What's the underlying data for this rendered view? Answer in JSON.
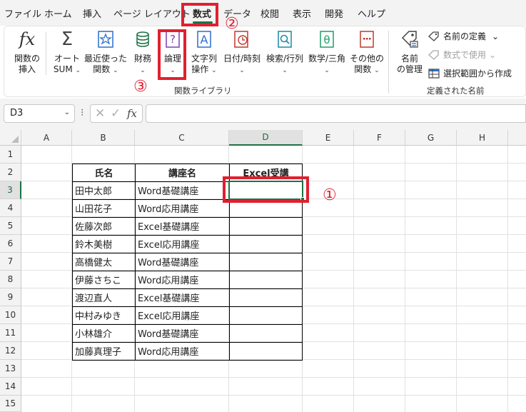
{
  "menu": {
    "tabs": [
      {
        "label": "ファイル"
      },
      {
        "label": "ホーム"
      },
      {
        "label": "挿入"
      },
      {
        "label": "ページ レイアウト"
      },
      {
        "label": "数式"
      },
      {
        "label": "データ"
      },
      {
        "label": "校閲"
      },
      {
        "label": "表示"
      },
      {
        "label": "開発"
      },
      {
        "label": "ヘルプ"
      }
    ],
    "active": "数式"
  },
  "ribbon": {
    "function_library": {
      "insert_function": "関数の\n挿入",
      "autosum": "オート\nSUM",
      "recent": "最近使った\n関数",
      "financial": "財務",
      "logical": "論理",
      "text": "文字列\n操作",
      "datetime": "日付/時刻",
      "lookup": "検索/行列",
      "math": "数学/三角",
      "more": "その他の\n関数",
      "group_label": "関数ライブラリ"
    },
    "defined_names": {
      "name_manager": "名前\nの管理",
      "define_name": "名前の定義",
      "use_in_formula": "数式で使用",
      "create_from_selection": "選択範囲から作成",
      "group_label": "定義された名前"
    }
  },
  "annotations": {
    "one": "①",
    "two": "②",
    "three": "③"
  },
  "formula_bar": {
    "name_box": "D3",
    "fx": "fx",
    "formula": ""
  },
  "sheet": {
    "columns": [
      "A",
      "B",
      "C",
      "D",
      "E",
      "F",
      "G",
      "H"
    ],
    "rows": [
      "1",
      "2",
      "3",
      "4",
      "5",
      "6",
      "7",
      "8",
      "9",
      "10",
      "11",
      "12",
      "13",
      "14",
      "15"
    ],
    "selected_cell": "D3",
    "table": {
      "headers": [
        "氏名",
        "講座名",
        "Excel受講"
      ],
      "rows": [
        {
          "name": "田中太郎",
          "course": "Word基礎講座",
          "excel": ""
        },
        {
          "name": "山田花子",
          "course": "Word応用講座",
          "excel": ""
        },
        {
          "name": "佐藤次郎",
          "course": "Excel基礎講座",
          "excel": ""
        },
        {
          "name": "鈴木美樹",
          "course": "Excel応用講座",
          "excel": ""
        },
        {
          "name": "高橋健太",
          "course": "Word基礎講座",
          "excel": ""
        },
        {
          "name": "伊藤さちこ",
          "course": "Word応用講座",
          "excel": ""
        },
        {
          "name": "渡辺直人",
          "course": "Excel基礎講座",
          "excel": ""
        },
        {
          "name": "中村みゆき",
          "course": "Excel応用講座",
          "excel": ""
        },
        {
          "name": "小林雄介",
          "course": "Word基礎講座",
          "excel": ""
        },
        {
          "name": "加藤真理子",
          "course": "Word応用講座",
          "excel": ""
        }
      ]
    }
  },
  "colors": {
    "accent": "#1e7145",
    "annotation": "#e02030"
  }
}
